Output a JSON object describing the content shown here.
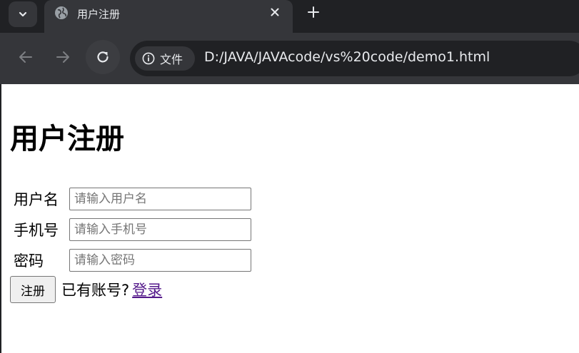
{
  "tab": {
    "title": "用户注册"
  },
  "address_bar": {
    "site_info_label": "文件",
    "url": "D:/JAVA/JAVAcode/vs%20code/demo1.html"
  },
  "page": {
    "title": "用户注册",
    "fields": [
      {
        "label": "用户名",
        "placeholder": "请输入用户名",
        "value": ""
      },
      {
        "label": "手机号",
        "placeholder": "请输入手机号",
        "value": ""
      },
      {
        "label": "密码",
        "placeholder": "请输入密码",
        "value": ""
      }
    ],
    "submit_label": "注册",
    "login_prompt": "已有账号?",
    "login_link": "登录"
  },
  "colors": {
    "tabstrip": "#202124",
    "toolbar": "#35363a",
    "link_visited": "#551a8b"
  }
}
